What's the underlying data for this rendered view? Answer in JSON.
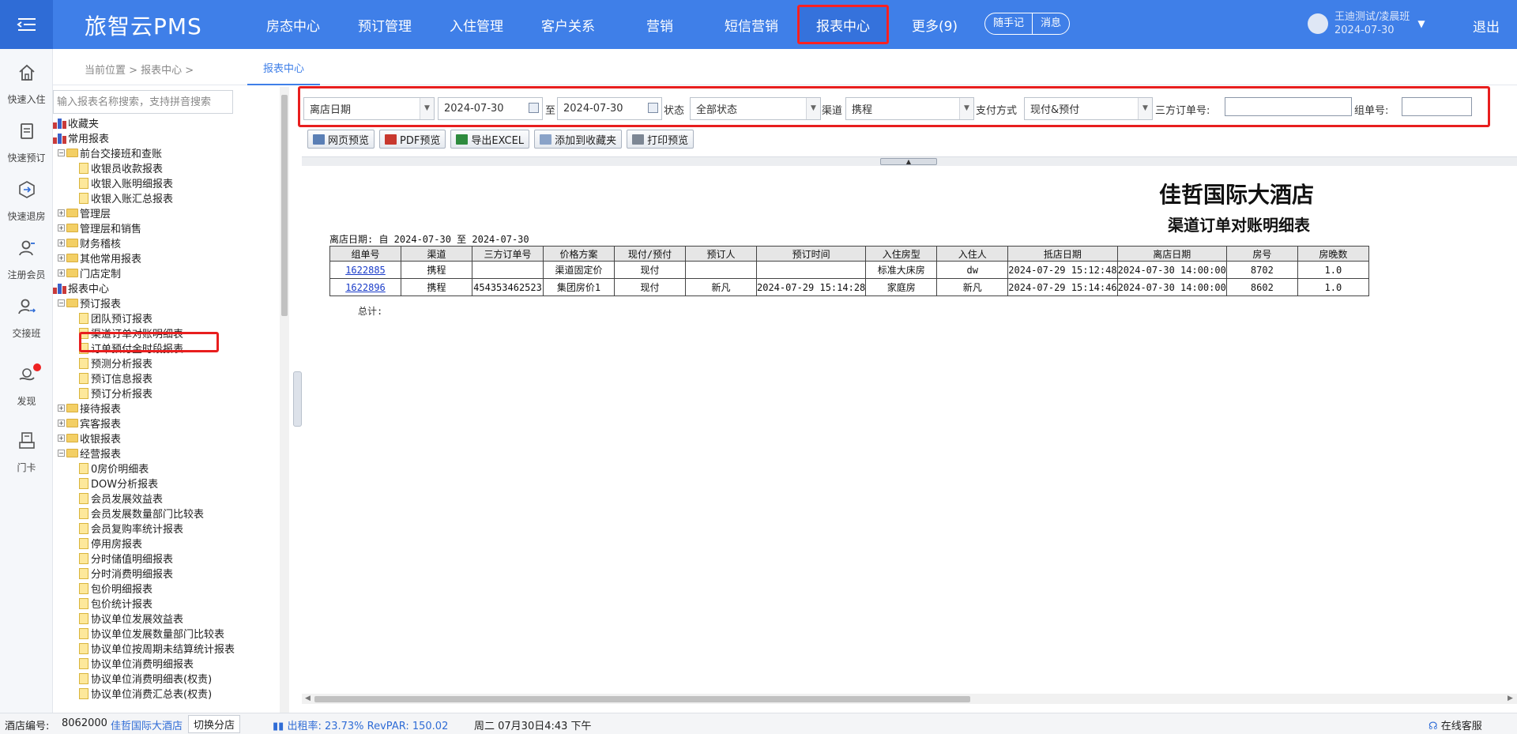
{
  "header": {
    "brand": "旅智云PMS",
    "nav": [
      "房态中心",
      "预订管理",
      "入住管理",
      "客户关系",
      "营销",
      "短信营销",
      "报表中心",
      "更多(9)"
    ],
    "active_nav": "报表中心",
    "pill": [
      "随手记",
      "消息"
    ],
    "user_name": "王迪测试/凌晨班",
    "user_date": "2024-07-30",
    "logout": "退出",
    "accent": "#3f7fe8"
  },
  "rail": [
    "快速入住",
    "快速预订",
    "快速退房",
    "注册会员",
    "交接班",
    "发现",
    "门卡"
  ],
  "breadcrumb": {
    "text": "当前位置  >  报表中心  >",
    "tab": "报表中心"
  },
  "tree": {
    "search_placeholder": "输入报表名称搜索，支持拼音搜索",
    "items": [
      {
        "label": "收藏夹",
        "level": 0,
        "kind": "fav"
      },
      {
        "label": "常用报表",
        "level": 0,
        "kind": "fav"
      },
      {
        "label": "前台交接班和查账",
        "level": 1,
        "kind": "folder",
        "open": true
      },
      {
        "label": "收银员收款报表",
        "level": 2,
        "kind": "doc"
      },
      {
        "label": "收银入账明细报表",
        "level": 2,
        "kind": "doc"
      },
      {
        "label": "收银入账汇总报表",
        "level": 2,
        "kind": "doc"
      },
      {
        "label": "管理层",
        "level": 1,
        "kind": "folder",
        "open": false
      },
      {
        "label": "管理层和销售",
        "level": 1,
        "kind": "folder",
        "open": false
      },
      {
        "label": "财务稽核",
        "level": 1,
        "kind": "folder",
        "open": false
      },
      {
        "label": "其他常用报表",
        "level": 1,
        "kind": "folder",
        "open": false
      },
      {
        "label": "门店定制",
        "level": 1,
        "kind": "folder",
        "open": false
      },
      {
        "label": "报表中心",
        "level": 0,
        "kind": "fav"
      },
      {
        "label": "预订报表",
        "level": 1,
        "kind": "folder",
        "open": true
      },
      {
        "label": "团队预订报表",
        "level": 2,
        "kind": "doc"
      },
      {
        "label": "渠道订单对账明细表",
        "level": 2,
        "kind": "doc"
      },
      {
        "label": "订单预付金时段报表",
        "level": 2,
        "kind": "doc"
      },
      {
        "label": "预测分析报表",
        "level": 2,
        "kind": "doc"
      },
      {
        "label": "预订信息报表",
        "level": 2,
        "kind": "doc"
      },
      {
        "label": "预订分析报表",
        "level": 2,
        "kind": "doc"
      },
      {
        "label": "接待报表",
        "level": 1,
        "kind": "folder",
        "open": false
      },
      {
        "label": "宾客报表",
        "level": 1,
        "kind": "folder",
        "open": false
      },
      {
        "label": "收银报表",
        "level": 1,
        "kind": "folder",
        "open": false
      },
      {
        "label": "经营报表",
        "level": 1,
        "kind": "folder",
        "open": true
      },
      {
        "label": "0房价明细表",
        "level": 2,
        "kind": "doc"
      },
      {
        "label": "DOW分析报表",
        "level": 2,
        "kind": "doc"
      },
      {
        "label": "会员发展效益表",
        "level": 2,
        "kind": "doc"
      },
      {
        "label": "会员发展数量部门比较表",
        "level": 2,
        "kind": "doc"
      },
      {
        "label": "会员复购率统计报表",
        "level": 2,
        "kind": "doc"
      },
      {
        "label": "停用房报表",
        "level": 2,
        "kind": "doc"
      },
      {
        "label": "分时储值明细报表",
        "level": 2,
        "kind": "doc"
      },
      {
        "label": "分时消费明细报表",
        "level": 2,
        "kind": "doc"
      },
      {
        "label": "包价明细报表",
        "level": 2,
        "kind": "doc"
      },
      {
        "label": "包价统计报表",
        "level": 2,
        "kind": "doc"
      },
      {
        "label": "协议单位发展效益表",
        "level": 2,
        "kind": "doc"
      },
      {
        "label": "协议单位发展数量部门比较表",
        "level": 2,
        "kind": "doc"
      },
      {
        "label": "协议单位按周期未结算统计报表",
        "level": 2,
        "kind": "doc"
      },
      {
        "label": "协议单位消费明细报表",
        "level": 2,
        "kind": "doc"
      },
      {
        "label": "协议单位消费明细表(权责)",
        "level": 2,
        "kind": "doc"
      },
      {
        "label": "协议单位消费汇总表(权责)",
        "level": 2,
        "kind": "doc"
      }
    ]
  },
  "filters": {
    "date_type": "离店日期",
    "date_from": "2024-07-30",
    "to_label": "至",
    "date_to": "2024-07-30",
    "status_label": "状态",
    "status": "全部状态",
    "channel_label": "渠道",
    "channel": "携程",
    "pay_label": "支付方式",
    "pay": "现付&预付",
    "third_label": "三方订单号:",
    "third_value": "",
    "group_label": "组单号:",
    "group_value": ""
  },
  "toolbar": [
    "网页预览",
    "PDF预览",
    "导出EXCEL",
    "添加到收藏夹",
    "打印预览"
  ],
  "report": {
    "hotel": "佳哲国际大酒店",
    "title": "渠道订单对账明细表",
    "date_range": "离店日期: 自 2024-07-30 至 2024-07-30",
    "columns": [
      "组单号",
      "渠道",
      "三方订单号",
      "价格方案",
      "现付/预付",
      "预订人",
      "预订时间",
      "入住房型",
      "入住人",
      "抵店日期",
      "离店日期",
      "房号",
      "房晚数"
    ],
    "rows": [
      [
        "1622885",
        "携程",
        "",
        "渠道固定价",
        "现付",
        "",
        "",
        "标准大床房",
        "dw",
        "2024-07-29 15:12:48",
        "2024-07-30 14:00:00",
        "8702",
        "1.0"
      ],
      [
        "1622896",
        "携程",
        "454353462523",
        "集团房价1",
        "现付",
        "新凡",
        "2024-07-29 15:14:28",
        "家庭房",
        "新凡",
        "2024-07-29 15:14:46",
        "2024-07-30 14:00:00",
        "8602",
        "1.0"
      ]
    ],
    "total_label": "总计:"
  },
  "statusbar": {
    "hotel_no_label": "酒店编号:",
    "hotel_no": "8062000",
    "hotel_name": "佳哲国际大酒店",
    "switch": "切换分店",
    "occupancy": "出租率: 23.73% RevPAR: 150.02",
    "datetime": "周二 07月30日4:43 下午",
    "service": "在线客服"
  }
}
